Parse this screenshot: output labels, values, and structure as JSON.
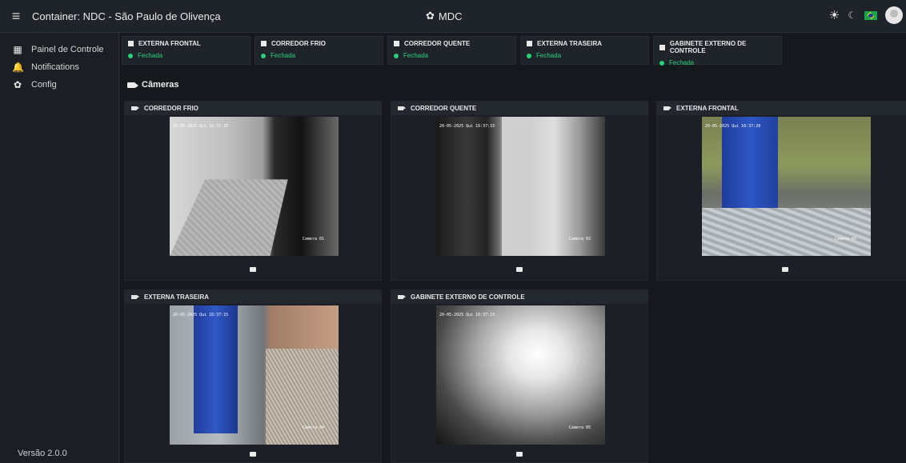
{
  "header": {
    "title": "Container: NDC - São Paulo de Olivença",
    "center_title": "MDC"
  },
  "sidebar": {
    "items": [
      {
        "label": "Painel de Controle",
        "icon": "dashboard-icon"
      },
      {
        "label": "Notifications",
        "icon": "bell-icon"
      },
      {
        "label": "Config",
        "icon": "gear-icon"
      }
    ],
    "version": "Versão 2.0.0"
  },
  "doors": [
    {
      "name": "EXTERNA FRONTAL",
      "state": "Fechada"
    },
    {
      "name": "CORREDOR FRIO",
      "state": "Fechada"
    },
    {
      "name": "CORREDOR QUENTE",
      "state": "Fechada"
    },
    {
      "name": "EXTERNA TRASEIRA",
      "state": "Fechada"
    },
    {
      "name": "GABINETE EXTERNO DE CONTROLE",
      "state": "Fechada"
    }
  ],
  "cameras_section": {
    "title": "Câmeras"
  },
  "cameras": [
    {
      "name": "CORREDOR FRIO",
      "timestamp": "20-05-2025 Qui 16:37:15",
      "label": "Camera 01"
    },
    {
      "name": "CORREDOR QUENTE",
      "timestamp": "20-05-2025 Qui 16:37:15",
      "label": "Camera 02"
    },
    {
      "name": "EXTERNA FRONTAL",
      "timestamp": "20-05-2025 Qui 16:37:20",
      "label": "Camera 03"
    },
    {
      "name": "EXTERNA TRASEIRA",
      "timestamp": "20-05-2025 Qui 16:37:15",
      "label": "Camera 04"
    },
    {
      "name": "GABINETE EXTERNO DE CONTROLE",
      "timestamp": "20-05-2025 Qui 16:37:15",
      "label": "Camera 05"
    }
  ],
  "colors": {
    "status_ok": "#2ad07a",
    "panel": "#1f242b",
    "background": "#15181d"
  }
}
